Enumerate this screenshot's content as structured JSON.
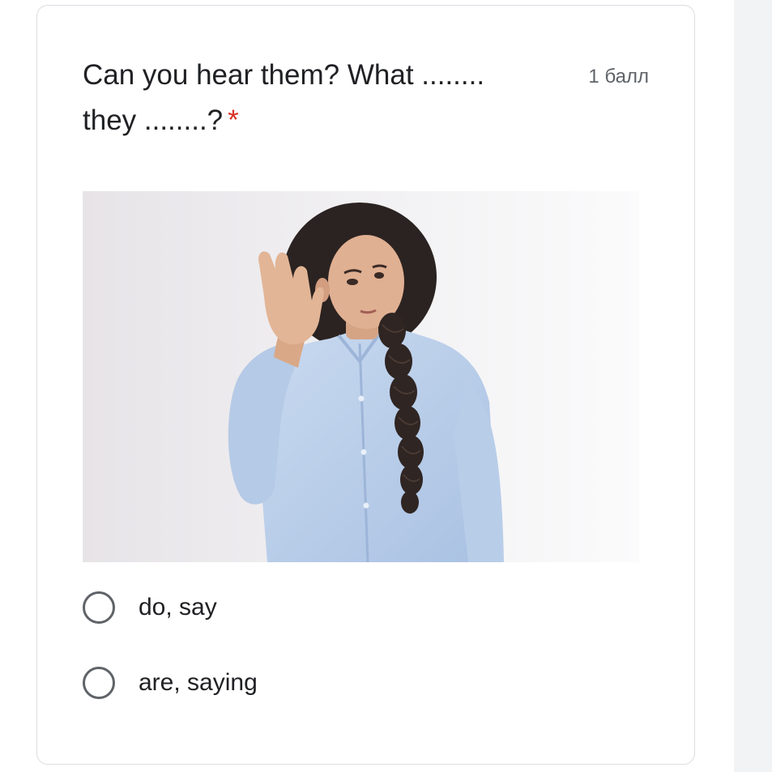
{
  "question": {
    "title": "Can you hear them? What ........ they ........?",
    "required_marker": "*",
    "points": "1 балл",
    "options": [
      {
        "label": "do, say"
      },
      {
        "label": "are, saying"
      }
    ]
  },
  "colors": {
    "required": "#d93025",
    "radio_border": "#5f6368",
    "text": "#202124",
    "muted_text": "#5f6368"
  }
}
